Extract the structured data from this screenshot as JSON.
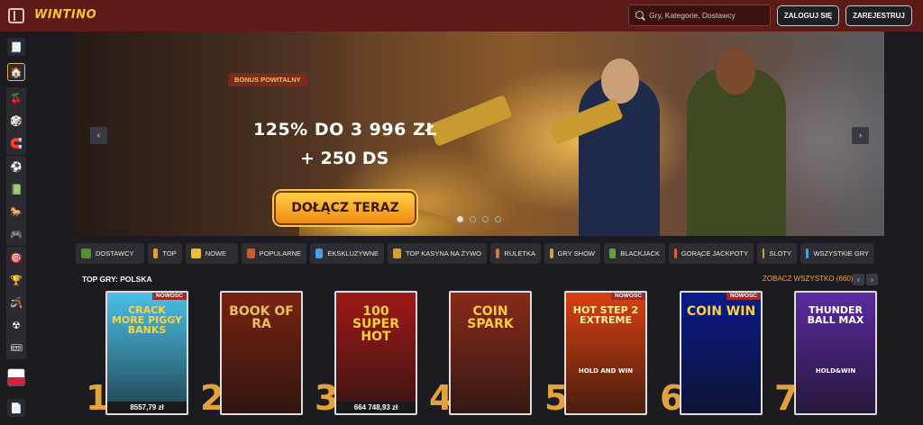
{
  "header": {
    "logo": "WINTINO",
    "search_placeholder": "Gry, Kategorie, Dostawcy",
    "login_label": "ZALOGUJ SIĘ",
    "register_label": "ZAREJESTRUJ",
    "bg_color": "#5c1b16"
  },
  "hero": {
    "badge": "BONUS POWITALNY",
    "offer_line1": "125% DO 3 996 ZŁ",
    "offer_line2": "+ 250 DS",
    "cta_label": "DOŁĄCZ TERAZ",
    "prev_icon": "‹",
    "next_icon": "›",
    "slide_count": 4,
    "active_slide": 1
  },
  "categories": [
    {
      "label": "DOSTAWCY",
      "icon": "book-icon",
      "color": "#5a8a3a"
    },
    {
      "label": "TOP",
      "icon": "crown-icon",
      "color": "#e0a030"
    },
    {
      "label": "NOWE",
      "icon": "lightning-icon",
      "color": "#e8c040"
    },
    {
      "label": "POPULARNE",
      "icon": "pistol-icon",
      "color": "#c06030"
    },
    {
      "label": "EKSKLUZYWNE",
      "icon": "diamond-icon",
      "color": "#4aa0e0"
    },
    {
      "label": "TOP KASYNA NA ŻYWO",
      "icon": "chip-icon",
      "color": "#d0a040"
    },
    {
      "label": "RULETKA",
      "icon": "roulette-icon",
      "color": "#c08040"
    },
    {
      "label": "GRY SHOW",
      "icon": "microphone-icon",
      "color": "#d0a040"
    },
    {
      "label": "BLACKJACK",
      "icon": "cards-icon",
      "color": "#6a9a4a"
    },
    {
      "label": "GORĄCE JACKPOTY",
      "icon": "fire-icon",
      "color": "#e06030"
    },
    {
      "label": "SLOTY",
      "icon": "slot-icon",
      "color": "#d0a040"
    },
    {
      "label": "WSZYSTKIE GRY",
      "icon": "diamond-icon",
      "color": "#4aa0e0"
    }
  ],
  "top_games": {
    "title": "TOP GRY: POLSKA",
    "see_all": "ZOBACZ WSZYSTKO (660)",
    "items": [
      {
        "rank": "1",
        "title": "CRACK MORE PIGGY BANKS",
        "new": "NOWOŚĆ",
        "jackpot": "8557,79 zł",
        "bg": "#4ac0e8",
        "fg": "#ffd23a"
      },
      {
        "rank": "2",
        "title": "BOOK OF RA",
        "new": "",
        "jackpot": "",
        "bg": "#7a2210",
        "fg": "#e8c060"
      },
      {
        "rank": "3",
        "title": "100 SUPER HOT",
        "new": "",
        "jackpot": "664 748,93 zł",
        "bg": "#a01818",
        "fg": "#ffd23a"
      },
      {
        "rank": "4",
        "title": "COIN SPARK",
        "new": "",
        "jackpot": "",
        "bg": "#8a2a18",
        "fg": "#ffcc40"
      },
      {
        "rank": "5",
        "title": "HOT STEP 2 EXTREME",
        "sub": "HOLD AND WIN",
        "new": "NOWOŚĆ",
        "jackpot": "",
        "bg": "#d84010",
        "fg": "#fff2a0"
      },
      {
        "rank": "6",
        "title": "COIN WIN",
        "new": "NOWOŚĆ",
        "jackpot": "",
        "bg": "#0a1a8a",
        "fg": "#ffd23a"
      },
      {
        "rank": "7",
        "title": "THUNDER BALL MAX",
        "sub": "HOLD&WIN",
        "new": "",
        "jackpot": "",
        "bg": "#5a2aa0",
        "fg": "#ffffff"
      }
    ]
  }
}
